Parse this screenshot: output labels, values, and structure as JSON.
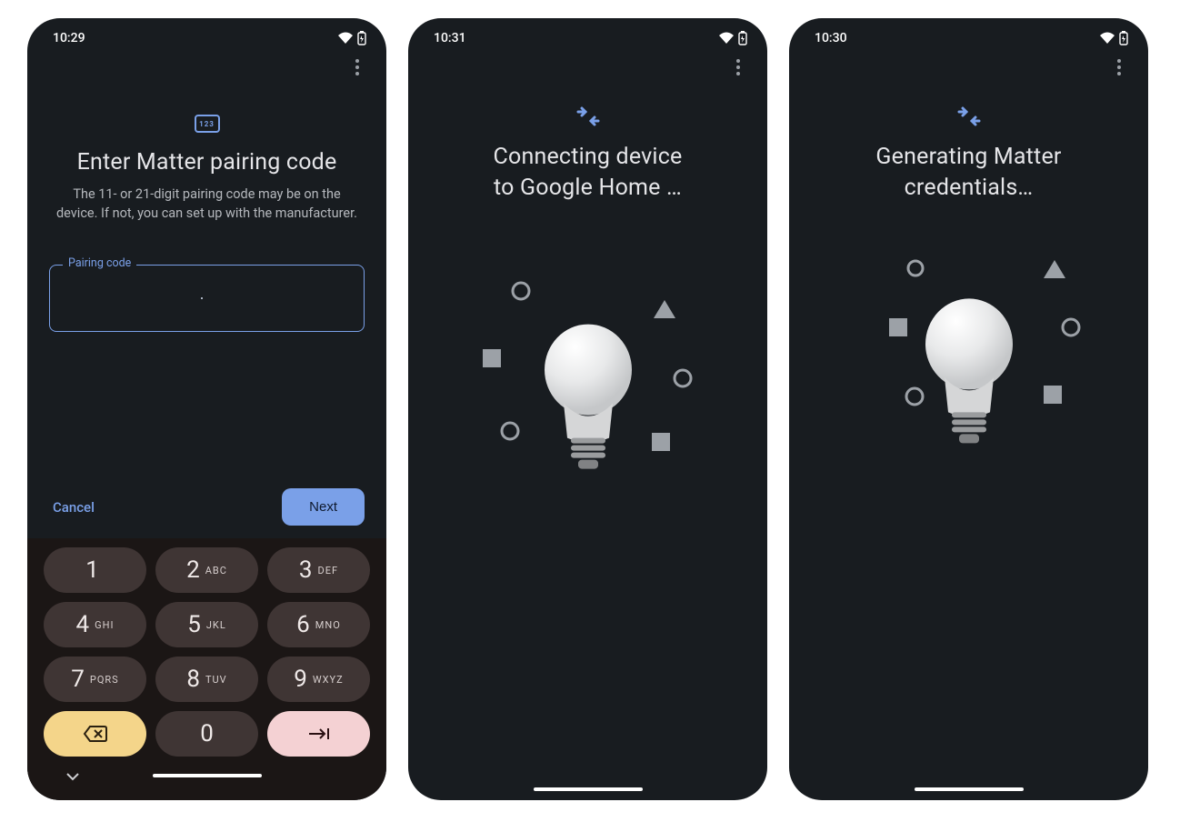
{
  "accent": "#7aa0e8",
  "screens": [
    {
      "time": "10:29",
      "badge_text": "123",
      "title": "Enter Matter pairing code",
      "subtitle": "The 11- or 21-digit pairing code may be on the device. If not, you can set up with the manufacturer.",
      "field_label": "Pairing code",
      "field_value": "",
      "cancel_label": "Cancel",
      "next_label": "Next",
      "keypad": {
        "rows": [
          [
            {
              "num": "1",
              "sub": ""
            },
            {
              "num": "2",
              "sub": "ABC"
            },
            {
              "num": "3",
              "sub": "DEF"
            }
          ],
          [
            {
              "num": "4",
              "sub": "GHI"
            },
            {
              "num": "5",
              "sub": "JKL"
            },
            {
              "num": "6",
              "sub": "MNO"
            }
          ],
          [
            {
              "num": "7",
              "sub": "PQRS"
            },
            {
              "num": "8",
              "sub": "TUV"
            },
            {
              "num": "9",
              "sub": "WXYZ"
            }
          ]
        ],
        "zero": {
          "num": "0",
          "sub": ""
        },
        "backspace_icon": "backspace",
        "submit_icon": "tab-next"
      }
    },
    {
      "time": "10:31",
      "title_line1": "Connecting device",
      "title_line2": "to Google Home …",
      "center_icon": "pair-arrows",
      "graphic": "lightbulb-with-shapes"
    },
    {
      "time": "10:30",
      "title": "Generating Matter credentials…",
      "center_icon": "pair-arrows",
      "graphic": "lightbulb-with-shapes"
    }
  ]
}
